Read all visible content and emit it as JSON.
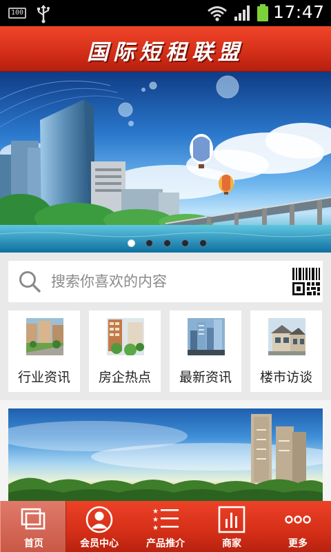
{
  "status_bar": {
    "battery_small": "100",
    "time": "17:47",
    "icons": [
      "battery-small-icon",
      "usb-icon",
      "wifi-icon",
      "signal-icon",
      "battery-icon"
    ]
  },
  "header": {
    "title": "国际短租联盟"
  },
  "banner": {
    "slide_count": 5,
    "active_slide": 1
  },
  "search": {
    "placeholder": "搜索你喜欢的内容",
    "icons": [
      "search-icon",
      "qr-code-icon"
    ]
  },
  "categories": [
    {
      "label": "行业资讯",
      "icon": "industry-news-thumbnail"
    },
    {
      "label": "房企热点",
      "icon": "developer-hot-thumbnail"
    },
    {
      "label": "最新资讯",
      "icon": "latest-news-thumbnail"
    },
    {
      "label": "楼市访谈",
      "icon": "market-interview-thumbnail"
    }
  ],
  "bottom_nav": [
    {
      "label": "首页",
      "icon": "home-icon",
      "active": true
    },
    {
      "label": "会员中心",
      "icon": "member-icon",
      "active": false
    },
    {
      "label": "产品推介",
      "icon": "product-list-icon",
      "active": false
    },
    {
      "label": "商家",
      "icon": "merchant-icon",
      "active": false
    },
    {
      "label": "更多",
      "icon": "more-icon",
      "active": false
    }
  ],
  "colors": {
    "header_red": "#d6301a",
    "nav_red": "#d52f18",
    "page_bg": "#e9e9e9"
  }
}
